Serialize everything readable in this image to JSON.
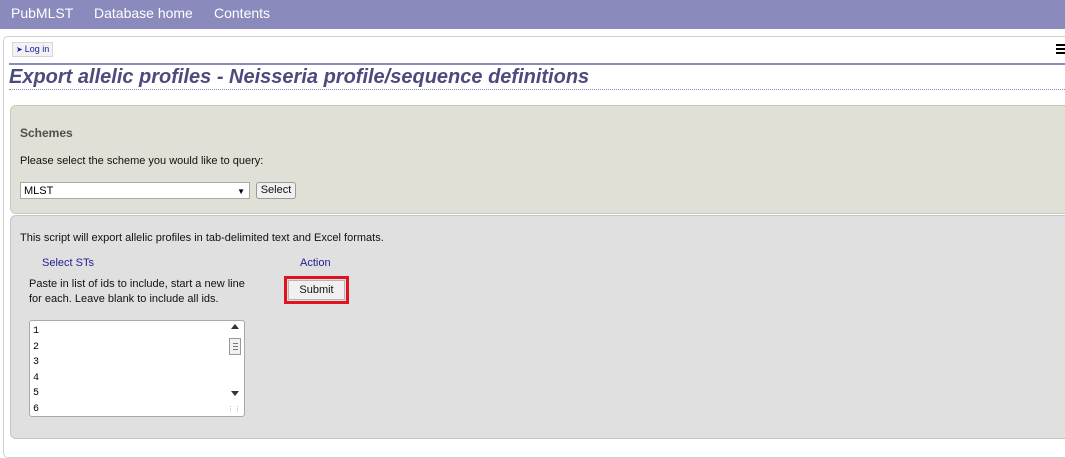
{
  "nav": {
    "items": [
      "PubMLST",
      "Database home",
      "Contents"
    ]
  },
  "login": {
    "label": "Log in",
    "icon": "login-icon"
  },
  "menu_icon": "menu-icon",
  "page": {
    "title": "Export allelic profiles - Neisseria profile/sequence definitions"
  },
  "schemes": {
    "heading": "Schemes",
    "prompt": "Please select the scheme you would like to query:",
    "selected": "MLST",
    "button_label": "Select"
  },
  "query": {
    "intro": "This script will export allelic profiles in tab-delimited text and Excel formats.",
    "select_legend": "Select STs",
    "help": "Paste in list of ids to include, start a new line for each. Leave blank to include all ids.",
    "ids": [
      "1",
      "2",
      "3",
      "4",
      "5",
      "6"
    ],
    "action_legend": "Action",
    "submit_label": "Submit"
  },
  "colors": {
    "nav_bg": "#8a8abd",
    "title": "#4b4b7d",
    "schemes_bg": "#e0e0d6",
    "query_bg": "#e0e0e0",
    "highlight": "#e0131f"
  }
}
